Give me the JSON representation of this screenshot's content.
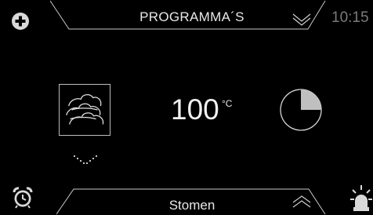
{
  "header": {
    "title": "PROGRAMMA´S",
    "time": "10:15"
  },
  "main": {
    "temperature": "100",
    "unit": "°C"
  },
  "footer": {
    "title": "Stomen"
  },
  "icons": {
    "top_left": "add-icon",
    "top_right": "chevron-down-icon",
    "mode": "steam-icon",
    "mode_expand": "chevron-down-dotted-icon",
    "timer": "timer-icon",
    "bottom_left": "alarm-clock-icon",
    "bottom_right": "light-icon",
    "bottom_chevron": "chevron-up-icon"
  },
  "colors": {
    "background": "#000000",
    "text": "#e6e6e6",
    "muted": "#7a7a7a",
    "outline": "#bdbdbd"
  },
  "timer": {
    "fraction_filled": 0.25
  }
}
